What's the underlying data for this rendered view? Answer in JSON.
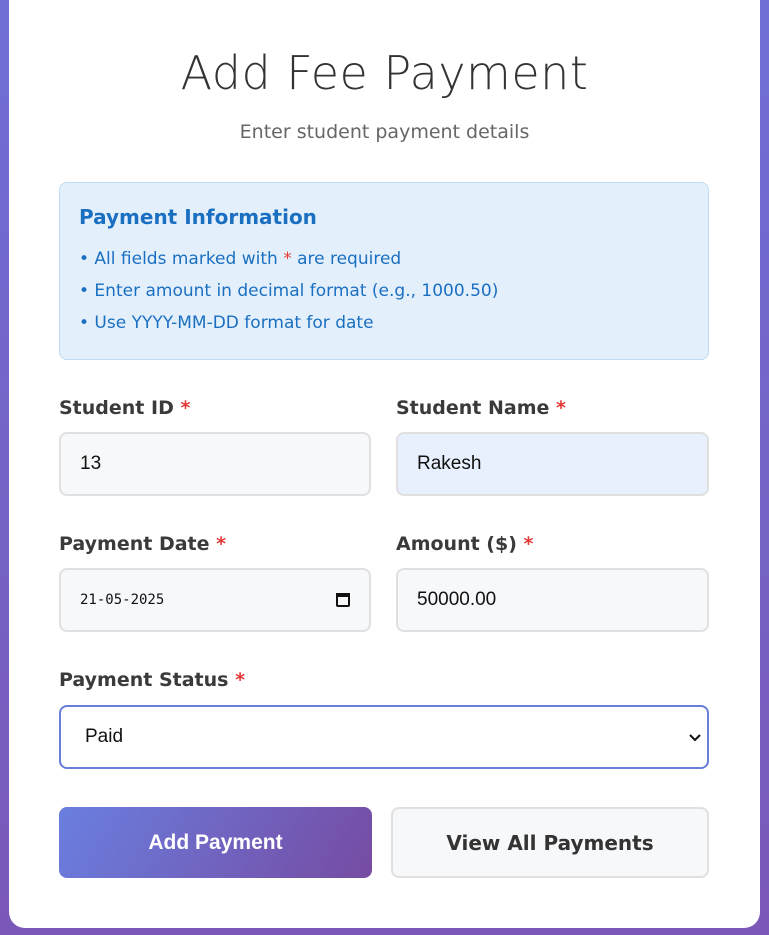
{
  "header": {
    "title": "Add Fee Payment",
    "subtitle": "Enter student payment details"
  },
  "info": {
    "title": "Payment Information",
    "items": [
      {
        "prefix": "• All fields marked with ",
        "marker": "*",
        "suffix": " are required"
      },
      {
        "text": "• Enter amount in decimal format (e.g., 1000.50)"
      },
      {
        "text": "• Use YYYY-MM-DD format for date"
      }
    ]
  },
  "required_marker": "*",
  "form": {
    "student_id": {
      "label": "Student ID",
      "value": "13"
    },
    "student_name": {
      "label": "Student Name",
      "value": "Rakesh"
    },
    "payment_date": {
      "label": "Payment Date",
      "value": "21-05-2025"
    },
    "amount": {
      "label": "Amount ($)",
      "value": "50000.00"
    },
    "payment_status": {
      "label": "Payment Status",
      "value": "Paid"
    }
  },
  "buttons": {
    "primary": "Add Payment",
    "secondary": "View All Payments"
  },
  "icons": {
    "calendar": "calendar-icon",
    "dropdown": "chevron-down-icon"
  },
  "colors": {
    "accent_start": "#6a7fe0",
    "accent_end": "#764ba2",
    "info_text": "#1b6fc1",
    "required": "#e53935"
  }
}
